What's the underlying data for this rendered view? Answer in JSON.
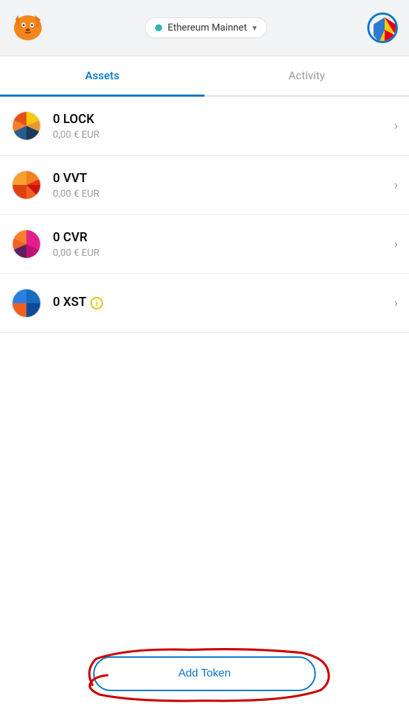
{
  "header": {
    "network": {
      "label": "Ethereum Mainnet",
      "dot_color": "#29b6af"
    }
  },
  "tabs": [
    {
      "id": "assets",
      "label": "Assets",
      "active": true
    },
    {
      "id": "activity",
      "label": "Activity",
      "active": false
    }
  ],
  "tokens": [
    {
      "id": "lock",
      "symbol": "LOCK",
      "amount": "0 LOCK",
      "eur": "0,00 € EUR",
      "has_info": false
    },
    {
      "id": "vvt",
      "symbol": "VVT",
      "amount": "0 VVT",
      "eur": "0,00 € EUR",
      "has_info": false
    },
    {
      "id": "cvr",
      "symbol": "CVR",
      "amount": "0 CVR",
      "eur": "0,00 € EUR",
      "has_info": false
    },
    {
      "id": "xst",
      "symbol": "XST",
      "amount": "0 XST",
      "eur": "",
      "has_info": true
    }
  ],
  "add_token_button": {
    "label": "Add Token"
  },
  "colors": {
    "accent": "#0376c9",
    "scribble": "#cc0000"
  }
}
